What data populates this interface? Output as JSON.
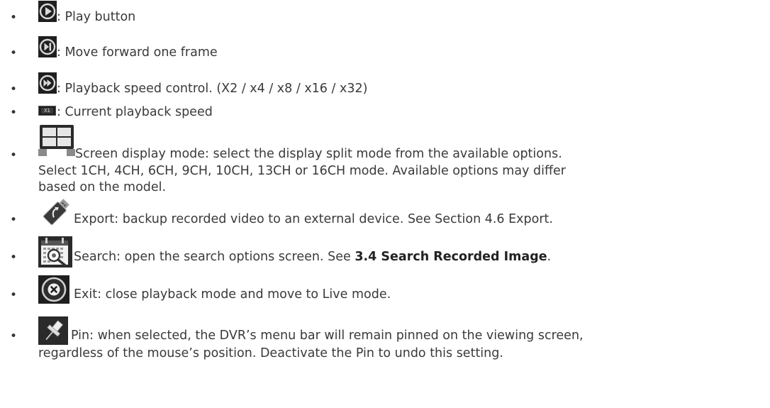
{
  "items": [
    {
      "icon": "play-circle-icon",
      "text": ": Play button"
    },
    {
      "icon": "step-forward-circle-icon",
      "text": ": Move forward one frame"
    },
    {
      "icon": "fast-forward-circle-icon",
      "text": ": Playback speed control. (X2 / x4 / x8 / x16 / x32)"
    },
    {
      "icon": "speed-badge-icon",
      "badge": "X1",
      "text": ": Current playback speed"
    },
    {
      "icon": "split-screen-icon",
      "lines": [
        " Screen display mode: select the display split mode from the available options.",
        "Select 1CH, 4CH, 6CH, 9CH, 10CH, 13CH or 16CH mode. Available options may differ",
        "based on the model."
      ]
    },
    {
      "icon": "usb-export-icon",
      "text": " Export: backup recorded video to an external device. See Section 4.6 Export."
    },
    {
      "icon": "calendar-search-icon",
      "text_before": " Search: open the search options screen. See ",
      "link": "3.4 Search Recorded Image",
      "text_after": "."
    },
    {
      "icon": "close-circle-icon",
      "text": " Exit: close playback mode and move to Live mode."
    },
    {
      "icon": "pin-icon",
      "lines": [
        "Pin: when selected, the DVR’s menu bar will remain pinned on the viewing screen,",
        "regardless of the mouse’s position. Deactivate the Pin to undo this setting."
      ]
    }
  ],
  "bullet_char": "•",
  "colors": {
    "icon_bg": "#1f1f1f",
    "icon_fg": "#d9d9d9",
    "pin_bg": "#2a2a2a",
    "text": "#3a3a3a"
  }
}
